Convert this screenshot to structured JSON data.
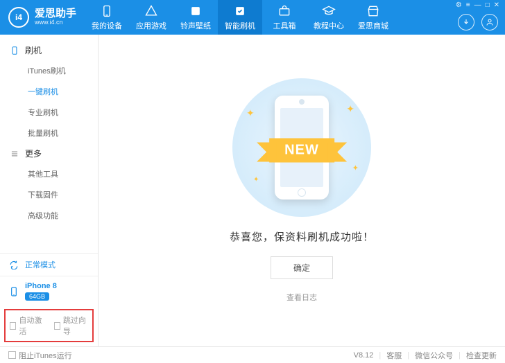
{
  "app": {
    "name": "爱思助手",
    "url": "www.i4.cn",
    "logo_text": "i4"
  },
  "nav": [
    {
      "label": "我的设备"
    },
    {
      "label": "应用游戏"
    },
    {
      "label": "铃声壁纸"
    },
    {
      "label": "智能刷机",
      "active": true
    },
    {
      "label": "工具箱"
    },
    {
      "label": "教程中心"
    },
    {
      "label": "爱思商城"
    }
  ],
  "window_controls": [
    "⚙",
    "≡",
    "—",
    "□",
    "✕"
  ],
  "sidebar": {
    "sections": [
      {
        "title": "刷机",
        "items": [
          {
            "label": "iTunes刷机"
          },
          {
            "label": "一键刷机",
            "active": true
          },
          {
            "label": "专业刷机"
          },
          {
            "label": "批量刷机"
          }
        ]
      },
      {
        "title": "更多",
        "items": [
          {
            "label": "其他工具"
          },
          {
            "label": "下载固件"
          },
          {
            "label": "高级功能"
          }
        ]
      }
    ],
    "mode": "正常模式",
    "device": {
      "name": "iPhone 8",
      "storage": "64GB"
    },
    "options": [
      {
        "label": "自动激活"
      },
      {
        "label": "跳过向导"
      }
    ]
  },
  "main": {
    "ribbon": "NEW",
    "message": "恭喜您，保资料刷机成功啦！",
    "confirm": "确定",
    "view_log": "查看日志"
  },
  "footer": {
    "block_itunes": "阻止iTunes运行",
    "version": "V8.12",
    "links": [
      "客服",
      "微信公众号",
      "检查更新"
    ]
  }
}
